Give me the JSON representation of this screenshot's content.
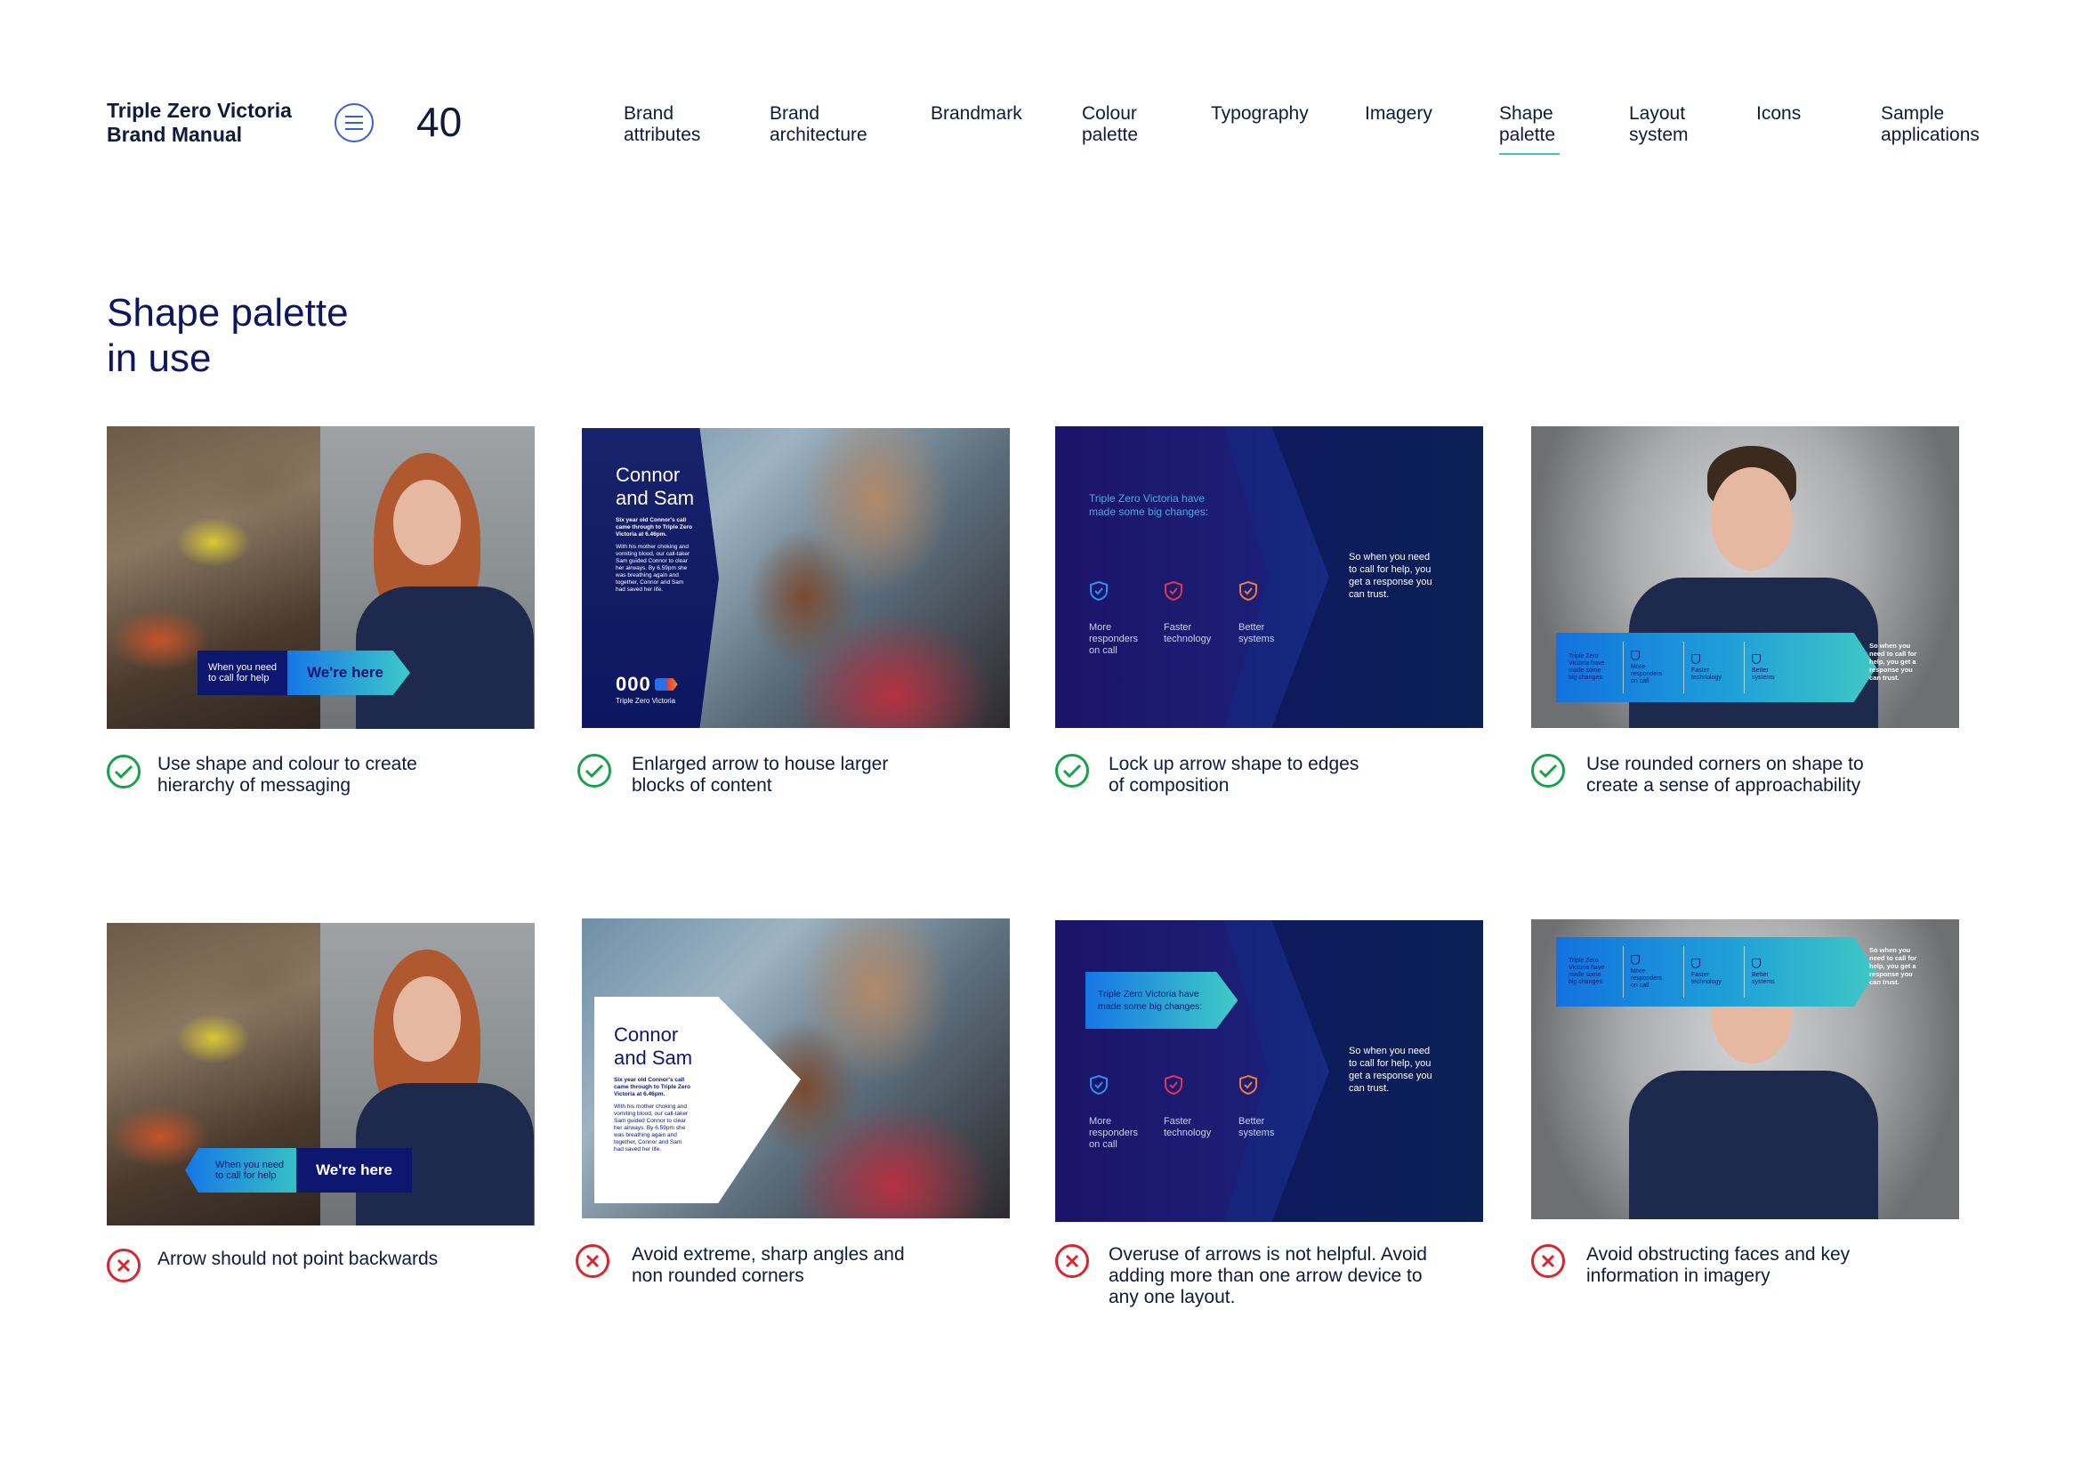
{
  "header": {
    "brand_line1": "Triple Zero Victoria",
    "brand_line2": "Brand Manual",
    "page_number": "40",
    "nav": [
      {
        "label": "Brand\nattributes",
        "active": false
      },
      {
        "label": "Brand\narchitecture",
        "active": false
      },
      {
        "label": "Brandmark",
        "active": false
      },
      {
        "label": "Colour\npalette",
        "active": false
      },
      {
        "label": "Typography",
        "active": false
      },
      {
        "label": "Imagery",
        "active": false
      },
      {
        "label": "Shape\npalette",
        "active": true
      },
      {
        "label": "Layout\nsystem",
        "active": false
      },
      {
        "label": "Icons",
        "active": false
      },
      {
        "label": "Sample\napplications",
        "active": false
      }
    ]
  },
  "title": "Shape palette\nin use",
  "colors": {
    "navy": "#0d1770",
    "accent_teal": "#41c2c7",
    "check_green": "#17a24a",
    "cross_red": "#d8262d",
    "gradient_blue": "#1677e6"
  },
  "samples": {
    "banner_small": "When you need\nto call for help",
    "banner_big": "We're here",
    "story_title": "Connor\nand Sam",
    "story_body_bold": "Six year old Connor's call\ncame through to Triple Zero\nVictoria at 6.46pm.",
    "story_body": "With his mother choking and\nvomiting blood, our call-taker\nSam guided Connor to clear\nher airways. By 6.59pm she\nwas breathing again and\ntogether, Connor and Sam\nhad saved her life.",
    "logo_text": "000",
    "logo_sub": "Triple Zero Victoria",
    "intro": "Triple Zero Victoria have\nmade some big changes:",
    "stat1": "More\nresponders\non call",
    "stat2": "Faster\ntechnology",
    "stat3": "Better\nsystems",
    "side": "So when you need\nto call for help, you\nget a response you\ncan trust.",
    "strip_lead": "Triple Zero\nVictoria have\nmade some\nbig changes:",
    "strip1": "More\nresponders\non call",
    "strip2": "Faster\ntechnology",
    "strip3": "Better\nsystems",
    "strip_note": "So when you\nneed to call for\nhelp, you get a\nresponse you\ncan trust."
  },
  "dos": [
    "Use shape and colour to create\nhierarchy of messaging",
    "Enlarged arrow to house larger\nblocks of content",
    "Lock up arrow shape to edges\nof composition",
    "Use rounded corners on shape to\ncreate a sense of approachability"
  ],
  "donts": [
    "Arrow should not point backwards",
    "Avoid extreme, sharp angles and\nnon rounded corners",
    "Overuse of arrows is not helpful. Avoid\nadding more than one arrow device to\nany one layout.",
    "Avoid obstructing faces and key\ninformation in imagery"
  ]
}
